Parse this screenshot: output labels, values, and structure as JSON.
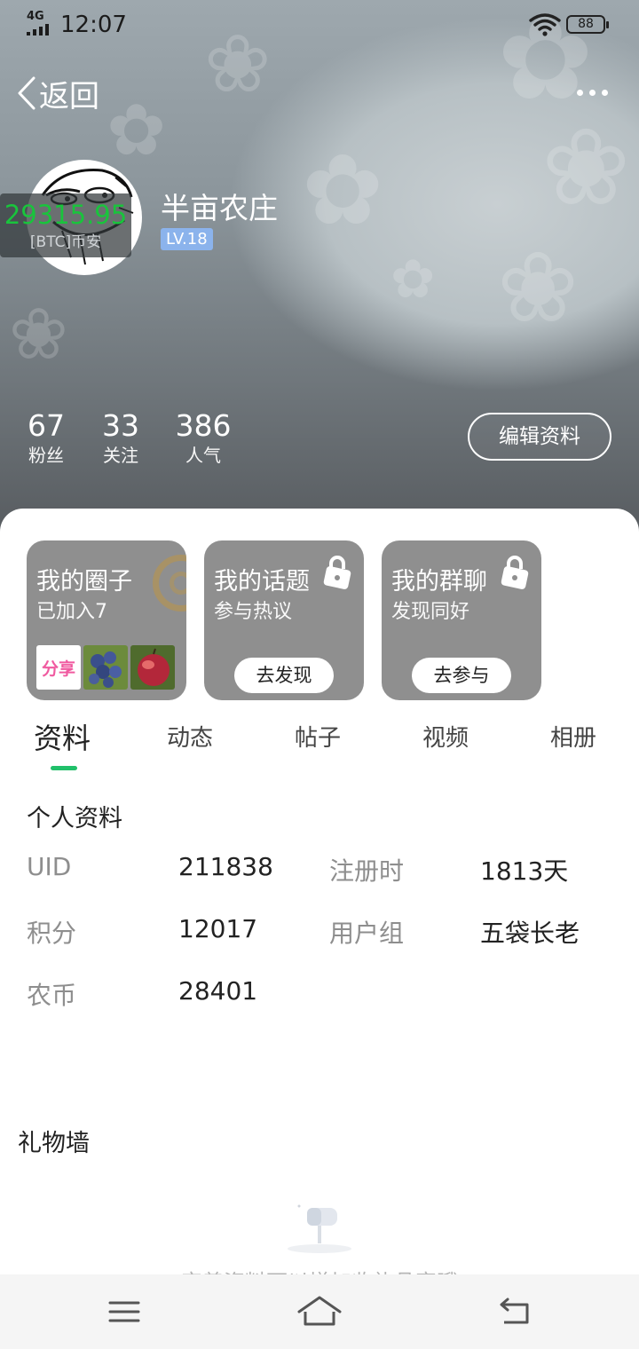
{
  "status_bar": {
    "network": "4G",
    "time": "12:07",
    "battery": "88",
    "icons": [
      "signal-icon",
      "wifi-icon",
      "battery-icon"
    ]
  },
  "header": {
    "back_label": "返回",
    "more_icon": "more-icon"
  },
  "ticker": {
    "price": "29315.95",
    "pair": "[BTC]币安"
  },
  "profile": {
    "nickname": "半亩农庄",
    "level": "LV.18"
  },
  "stats": [
    {
      "value": "67",
      "label": "粉丝"
    },
    {
      "value": "33",
      "label": "关注"
    },
    {
      "value": "386",
      "label": "人气"
    }
  ],
  "edit_button": "编辑资料",
  "cards": [
    {
      "title": "我的圈子",
      "subtitle": "已加入7",
      "thumb_label": "分享"
    },
    {
      "title": "我的话题",
      "subtitle": "参与热议",
      "button": "去发现"
    },
    {
      "title": "我的群聊",
      "subtitle": "发现同好",
      "button": "去参与"
    }
  ],
  "tabs": [
    "资料",
    "动态",
    "帖子",
    "视频",
    "相册"
  ],
  "active_tab": "资料",
  "personal_info": {
    "title": "个人资料",
    "fields": [
      {
        "key": "UID",
        "value": "211838"
      },
      {
        "key": "注册时",
        "value": "1813天"
      },
      {
        "key": "积分",
        "value": "12017"
      },
      {
        "key": "用户组",
        "value": "五袋长老"
      },
      {
        "key": "农币",
        "value": "28401"
      }
    ]
  },
  "gift_wall": {
    "title": "礼物墙",
    "empty_text": "完善资料可以增加收礼品客哦"
  },
  "colors": {
    "accent": "#21c06a",
    "level_badge": "#8bb3ec",
    "card_bg": "#8f8f8f",
    "ticker_price": "#19c43c"
  },
  "nav": [
    "menu-icon",
    "home-icon",
    "back-nav-icon"
  ]
}
